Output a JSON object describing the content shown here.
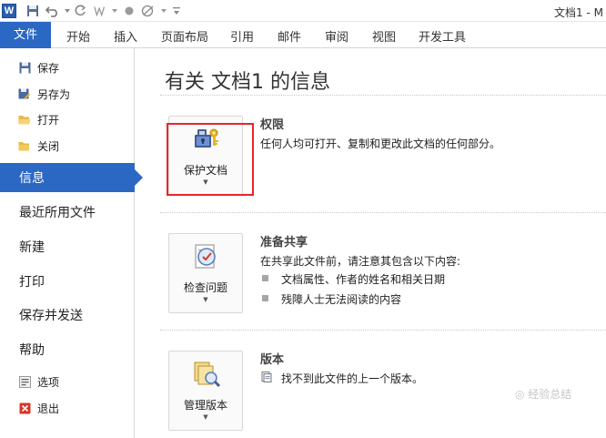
{
  "title_bar": {
    "doc_title": "文档1 - M"
  },
  "qat_icons": [
    "word-logo-icon",
    "save-icon",
    "undo-icon",
    "redo-icon",
    "format-painter-icon",
    "record-icon",
    "no-edit-icon",
    "customize-dropdown-icon"
  ],
  "qat": {
    "logo_letter": "W"
  },
  "ribbon": {
    "tabs": [
      "文件",
      "开始",
      "插入",
      "页面布局",
      "引用",
      "邮件",
      "审阅",
      "视图",
      "开发工具"
    ]
  },
  "nav": {
    "save": "保存",
    "save_as": "另存为",
    "open": "打开",
    "close": "关闭",
    "info": "信息",
    "recent": "最近所用文件",
    "new": "新建",
    "print": "打印",
    "save_send": "保存并发送",
    "help": "帮助",
    "options": "选项",
    "exit": "退出"
  },
  "info": {
    "heading": "有关 文档1 的信息",
    "permissions": {
      "button": "保护文档",
      "title": "权限",
      "desc": "任何人均可打开、复制和更改此文档的任何部分。"
    },
    "prepare": {
      "button": "检查问题",
      "title": "准备共享",
      "desc": "在共享此文件前，请注意其包含以下内容:",
      "bullets": [
        "文档属性、作者的姓名和相关日期",
        "残障人士无法阅读的内容"
      ]
    },
    "versions": {
      "button": "管理版本",
      "title": "版本",
      "desc": "找不到此文件的上一个版本。"
    }
  },
  "watermark": "◎ 经验总结",
  "colors": {
    "accent": "#2b68c4",
    "highlight": "#e8262b"
  }
}
